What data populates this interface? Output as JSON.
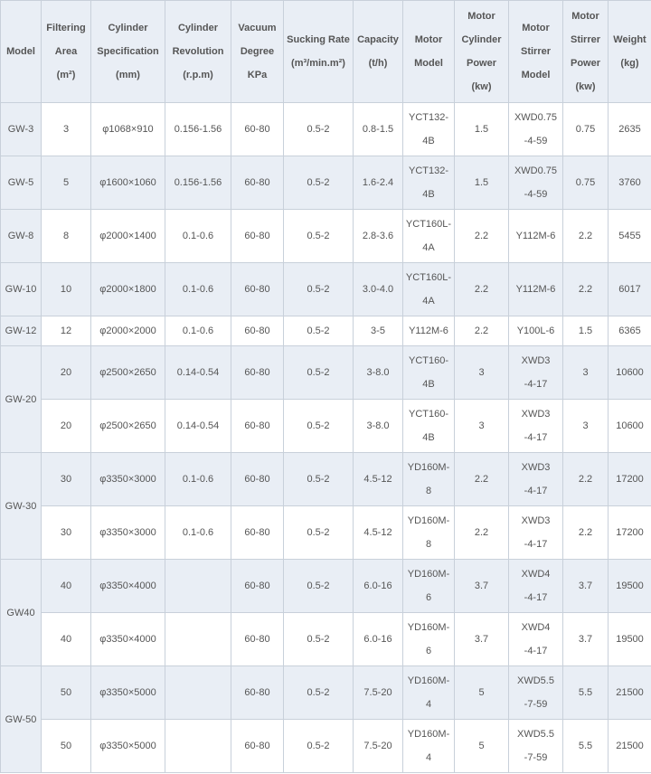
{
  "headers": [
    {
      "key": "model",
      "lines": [
        "Model"
      ]
    },
    {
      "key": "area",
      "lines": [
        "Filtering",
        "Area",
        "(m²)"
      ]
    },
    {
      "key": "spec",
      "lines": [
        "Cylinder",
        "Specification",
        "(mm)"
      ]
    },
    {
      "key": "rev",
      "lines": [
        "Cylinder",
        "Revolution",
        "(r.p.m)"
      ]
    },
    {
      "key": "vac",
      "lines": [
        "Vacuum",
        "Degree",
        "KPa"
      ]
    },
    {
      "key": "suck",
      "lines": [
        "Sucking Rate",
        "(m³/min.m²)"
      ]
    },
    {
      "key": "cap",
      "lines": [
        "Capacity",
        "(t/h)"
      ]
    },
    {
      "key": "mm",
      "lines": [
        "Motor",
        "Model"
      ]
    },
    {
      "key": "mcp",
      "lines": [
        "Motor",
        "Cylinder",
        "Power",
        "(kw)"
      ]
    },
    {
      "key": "msm",
      "lines": [
        "Motor",
        "Stirrer",
        "Model"
      ]
    },
    {
      "key": "msp",
      "lines": [
        "Motor",
        "Stirrer",
        "Power",
        "(kw)"
      ]
    },
    {
      "key": "weight",
      "lines": [
        "Weight",
        "(kg)"
      ]
    }
  ],
  "rows": [
    {
      "model": "GW-3",
      "span": 1,
      "cells": [
        "3",
        "φ1068×910",
        "0.156-1.56",
        "60-80",
        "0.5-2",
        "0.8-1.5",
        [
          "YCT132-",
          "4B"
        ],
        "1.5",
        [
          "XWD0.75",
          "-4-59"
        ],
        "0.75",
        "2635"
      ]
    },
    {
      "model": "GW-5",
      "span": 1,
      "cells": [
        "5",
        "φ1600×1060",
        "0.156-1.56",
        "60-80",
        "0.5-2",
        "1.6-2.4",
        [
          "YCT132-",
          "4B"
        ],
        "1.5",
        [
          "XWD0.75",
          "-4-59"
        ],
        "0.75",
        "3760"
      ]
    },
    {
      "model": "GW-8",
      "span": 1,
      "cells": [
        "8",
        "φ2000×1400",
        "0.1-0.6",
        "60-80",
        "0.5-2",
        "2.8-3.6",
        [
          "YCT160L-",
          "4A"
        ],
        "2.2",
        "Y112M-6",
        "2.2",
        "5455"
      ]
    },
    {
      "model": "GW-10",
      "span": 1,
      "cells": [
        "10",
        "φ2000×1800",
        "0.1-0.6",
        "60-80",
        "0.5-2",
        "3.0-4.0",
        [
          "YCT160L-",
          "4A"
        ],
        "2.2",
        "Y112M-6",
        "2.2",
        "6017"
      ]
    },
    {
      "model": "GW-12",
      "span": 1,
      "short": true,
      "cells": [
        "12",
        "φ2000×2000",
        "0.1-0.6",
        "60-80",
        "0.5-2",
        "3-5",
        "Y112M-6",
        "2.2",
        "Y100L-6",
        "1.5",
        "6365"
      ]
    },
    {
      "model": "GW-20",
      "span": 2,
      "cells": [
        "20",
        "φ2500×2650",
        "0.14-0.54",
        "60-80",
        "0.5-2",
        "3-8.0",
        [
          "YCT160-",
          "4B"
        ],
        "3",
        [
          "XWD3",
          "-4-17"
        ],
        "3",
        "10600"
      ]
    },
    {
      "model": null,
      "cells": [
        "20",
        "φ2500×2650",
        "0.14-0.54",
        "60-80",
        "0.5-2",
        "3-8.0",
        [
          "YCT160-",
          "4B"
        ],
        "3",
        [
          "XWD3",
          "-4-17"
        ],
        "3",
        "10600"
      ]
    },
    {
      "model": "GW-30",
      "span": 2,
      "cells": [
        "30",
        "φ3350×3000",
        "0.1-0.6",
        "60-80",
        "0.5-2",
        "4.5-12",
        [
          "YD160M-",
          "8"
        ],
        "2.2",
        [
          "XWD3",
          "-4-17"
        ],
        "2.2",
        "17200"
      ]
    },
    {
      "model": null,
      "cells": [
        "30",
        "φ3350×3000",
        "0.1-0.6",
        "60-80",
        "0.5-2",
        "4.5-12",
        [
          "YD160M-",
          "8"
        ],
        "2.2",
        [
          "XWD3",
          "-4-17"
        ],
        "2.2",
        "17200"
      ]
    },
    {
      "model": "GW40",
      "span": 2,
      "cells": [
        "40",
        "φ3350×4000",
        "",
        "60-80",
        "0.5-2",
        "6.0-16",
        [
          "YD160M-",
          "6"
        ],
        "3.7",
        [
          "XWD4",
          "-4-17"
        ],
        "3.7",
        "19500"
      ]
    },
    {
      "model": null,
      "cells": [
        "40",
        "φ3350×4000",
        "",
        "60-80",
        "0.5-2",
        "6.0-16",
        [
          "YD160M-",
          "6"
        ],
        "3.7",
        [
          "XWD4",
          "-4-17"
        ],
        "3.7",
        "19500"
      ]
    },
    {
      "model": "GW-50",
      "span": 2,
      "cells": [
        "50",
        "φ3350×5000",
        "",
        "60-80",
        "0.5-2",
        "7.5-20",
        [
          "YD160M-",
          "4"
        ],
        "5",
        [
          "XWD5.5",
          "-7-59"
        ],
        "5.5",
        "21500"
      ]
    },
    {
      "model": null,
      "cells": [
        "50",
        "φ3350×5000",
        "",
        "60-80",
        "0.5-2",
        "7.5-20",
        [
          "YD160M-",
          "4"
        ],
        "5",
        [
          "XWD5.5",
          "-7-59"
        ],
        "5.5",
        "21500"
      ]
    }
  ]
}
